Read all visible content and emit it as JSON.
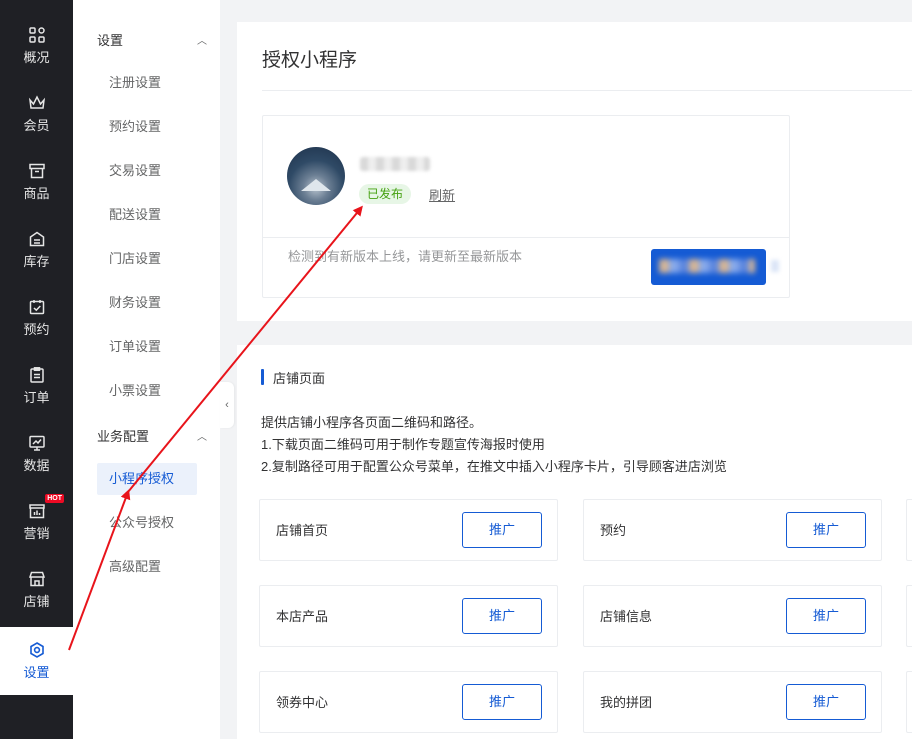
{
  "rail": {
    "items": [
      {
        "label": "概况",
        "icon": "grid-icon"
      },
      {
        "label": "会员",
        "icon": "crown-icon"
      },
      {
        "label": "商品",
        "icon": "shop-box-icon"
      },
      {
        "label": "库存",
        "icon": "inventory-icon"
      },
      {
        "label": "预约",
        "icon": "calendar-check-icon"
      },
      {
        "label": "订单",
        "icon": "clipboard-icon"
      },
      {
        "label": "数据",
        "icon": "chart-monitor-icon"
      },
      {
        "label": "营销",
        "icon": "marketing-icon",
        "badge": "HOT"
      },
      {
        "label": "店铺",
        "icon": "store-icon"
      },
      {
        "label": "设置",
        "icon": "settings-hex-icon",
        "active": true
      }
    ]
  },
  "subnav": {
    "groups": [
      {
        "title": "设置",
        "items": [
          "注册设置",
          "预约设置",
          "交易设置",
          "配送设置",
          "门店设置",
          "财务设置",
          "订单设置",
          "小票设置"
        ]
      },
      {
        "title": "业务配置",
        "items": [
          "小程序授权",
          "公众号授权",
          "高级配置"
        ],
        "active": "小程序授权"
      }
    ],
    "collapse_glyph": "‹",
    "chevron_glyph": "︿"
  },
  "main": {
    "title": "授权小程序",
    "mini_program": {
      "status": "已发布",
      "refresh_label": "刷新",
      "notice": "检测到有新版本上线，请更新至最新版本"
    },
    "pages_section": {
      "title": "店铺页面",
      "desc": [
        "提供店铺小程序各页面二维码和路径。",
        "1.下载页面二维码可用于制作专题宣传海报时使用",
        "2.复制路径可用于配置公众号菜单，在推文中插入小程序卡片，引导顾客进店浏览"
      ],
      "pages": [
        {
          "name": "店铺首页",
          "button": "推广"
        },
        {
          "name": "预约",
          "button": "推广"
        },
        {
          "name": "本店产品",
          "button": "推广"
        },
        {
          "name": "店铺信息",
          "button": "推广"
        },
        {
          "name": "领券中心",
          "button": "推广"
        },
        {
          "name": "我的拼团",
          "button": "推广"
        }
      ]
    }
  },
  "colors": {
    "rail_bg": "#1f2025",
    "primary": "#155bd4",
    "published_green": "#45a110",
    "annotation_red": "#e8141b"
  }
}
